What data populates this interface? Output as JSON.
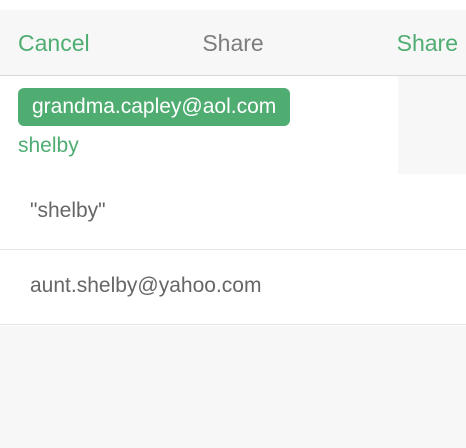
{
  "nav": {
    "cancel_label": "Cancel",
    "title": "Share",
    "share_label": "Share"
  },
  "recipients": {
    "token_email": "grandma.capley@aol.com",
    "typed_text": "shelby"
  },
  "suggestions": [
    {
      "label": "\"shelby\""
    },
    {
      "label": "aunt.shelby@yahoo.com"
    }
  ],
  "colors": {
    "accent": "#4fad72",
    "title_gray": "#7d7d7d",
    "suggestion_gray": "#666666",
    "bar_background": "#f7f7f7"
  }
}
